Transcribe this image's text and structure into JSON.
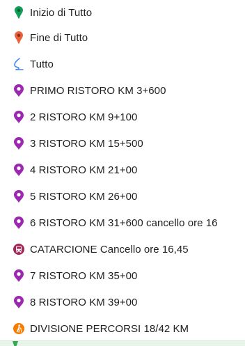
{
  "legend": {
    "items": [
      {
        "label": "Inizio di Tutto",
        "icon": "green-pin-icon",
        "color": "#0f9d58"
      },
      {
        "label": "Fine di Tutto",
        "icon": "red-pin-icon",
        "color": "#e8623c"
      },
      {
        "label": "Tutto",
        "icon": "route-icon",
        "color": "#4285f4"
      },
      {
        "label": "PRIMO RISTORO KM 3+600",
        "icon": "purple-marker-icon",
        "color": "#9c27b0"
      },
      {
        "label": "2 RISTORO KM 9+100",
        "icon": "purple-marker-icon",
        "color": "#9c27b0"
      },
      {
        "label": "3 RISTORO KM 15+500",
        "icon": "purple-marker-icon",
        "color": "#9c27b0"
      },
      {
        "label": "4 RISTORO KM 21+00",
        "icon": "purple-marker-icon",
        "color": "#9c27b0"
      },
      {
        "label": "5 RISTORO KM 26+00",
        "icon": "purple-marker-icon",
        "color": "#9c27b0"
      },
      {
        "label": "6 RISTORO KM 31+600 cancello ore 16",
        "icon": "purple-marker-icon",
        "color": "#9c27b0"
      },
      {
        "label": "CATARCIONE Cancello ore 16,45",
        "icon": "bus-marker-icon",
        "color": "#a52757"
      },
      {
        "label": "7 RISTORO KM 35+00",
        "icon": "purple-marker-icon",
        "color": "#9c27b0"
      },
      {
        "label": "8 RISTORO KM 39+00",
        "icon": "purple-marker-icon",
        "color": "#9c27b0"
      },
      {
        "label": "DIVISIONE PERCORSI 18/42 KM",
        "icon": "hiker-marker-icon",
        "color": "#f57c00"
      }
    ]
  }
}
